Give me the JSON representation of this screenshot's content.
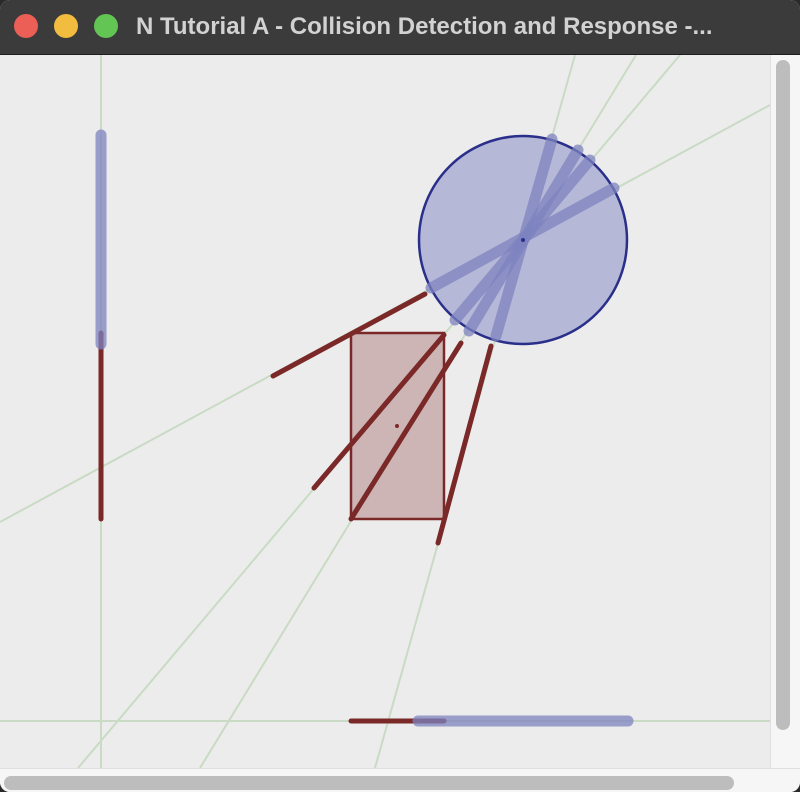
{
  "window": {
    "title": "N Tutorial A - Collision Detection and Response -..."
  },
  "controls": {
    "close": "close-button",
    "minimize": "minimize-button",
    "maximize": "maximize-button"
  },
  "colors": {
    "guide": "#c9dbc4",
    "shape_red": "#7a2828",
    "shape_red_fill": "#cdb5b5",
    "shape_blue": "#2a2f8a",
    "shape_blue_fill": "#b6b8d8",
    "projection_blue": "#8f94c7",
    "canvas_bg": "#ececec"
  },
  "scene": {
    "shapes": [
      "circle",
      "rectangle"
    ],
    "projection_axes": 6
  }
}
